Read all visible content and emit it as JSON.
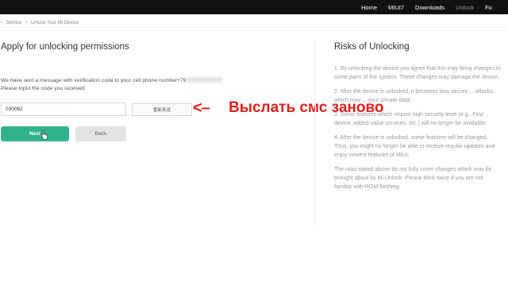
{
  "nav": {
    "items": [
      {
        "label": "Home"
      },
      {
        "label": "MIUI7"
      },
      {
        "label": "Downloads"
      },
      {
        "label": "Unlock"
      },
      {
        "label": "Fo"
      }
    ],
    "active": "Unlock"
  },
  "breadcrumb": {
    "items": [
      "Service",
      "Unlock Your Mi Device"
    ],
    "separator": ">"
  },
  "form": {
    "title": "Apply for unlocking permissions",
    "message_line1": "We have sent a message with verification code to your cell phone number+79",
    "message_line2": "Please input the code you received",
    "code_value": "030082",
    "resend_label": "重新发送",
    "next_label": "Next",
    "back_label": "Back"
  },
  "annotation": {
    "arrow": "<–",
    "text": "Выслать смс заново",
    "color": "#e02020"
  },
  "risks": {
    "title": "Risks of Unlocking",
    "items": [
      "1. By unlocking the device you agree that this may bring changes to some parts of the system. These changes may damage the device;",
      "2. After the device is unlocked, it becomes less secure ... attacks, which may ... your private data;",
      "3. Some features which require high security level (e.g., Find device, added-value services, etc.) will no longer be available;",
      "4. After the device is unlocked, some features will be changed. Thus, you might no longer be able to receive regular updates and enjoy newest features of MIUI;",
      "The risks stated above do not fully cover changes which may be brought about by Mi Unlock. Please think twice if you are not familiar with ROM flashing."
    ]
  },
  "colors": {
    "primary": "#30b38b",
    "topbar": "#111111"
  }
}
